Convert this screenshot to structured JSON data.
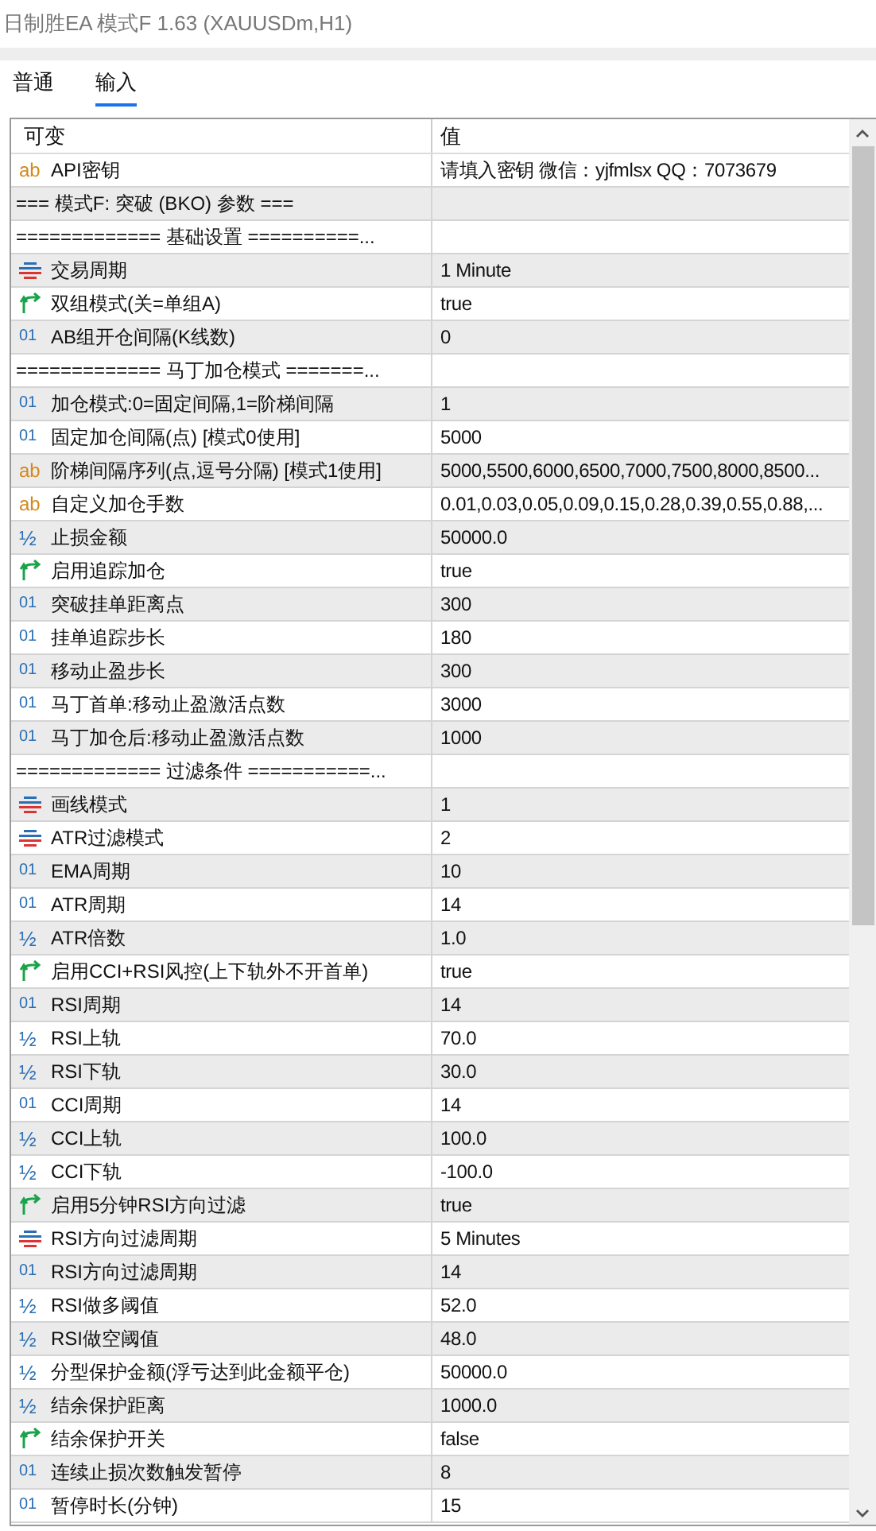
{
  "window": {
    "title": "日制胜EA 模式F 1.63 (XAUUSDm,H1)"
  },
  "tabs": [
    {
      "label": "普通",
      "selected": false
    },
    {
      "label": "输入",
      "selected": true
    }
  ],
  "table": {
    "columns": [
      "可变",
      "值"
    ],
    "rows": [
      {
        "kind": "string",
        "icon": "ab",
        "name": "API密钥",
        "value": "请填入密钥 微信：yjfmlsx QQ：7073679"
      },
      {
        "kind": "section",
        "name": "=== 模式F: 突破 (BKO) 参数 ==="
      },
      {
        "kind": "section",
        "name": "============= 基础设置 ==========..."
      },
      {
        "kind": "enum",
        "name": "交易周期",
        "value": "1 Minute"
      },
      {
        "kind": "bool",
        "name": "双组模式(关=单组A)",
        "value": "true"
      },
      {
        "kind": "int",
        "icon": "01",
        "name": "AB组开仓间隔(K线数)",
        "value": "0"
      },
      {
        "kind": "section",
        "name": "============= 马丁加仓模式 =======..."
      },
      {
        "kind": "int",
        "icon": "01",
        "name": "加仓模式:0=固定间隔,1=阶梯间隔",
        "value": "1"
      },
      {
        "kind": "int",
        "icon": "01",
        "name": "固定加仓间隔(点) [模式0使用]",
        "value": "5000"
      },
      {
        "kind": "string",
        "icon": "ab",
        "name": "阶梯间隔序列(点,逗号分隔) [模式1使用]",
        "value": "5000,5500,6000,6500,7000,7500,8000,8500..."
      },
      {
        "kind": "string",
        "icon": "ab",
        "name": "自定义加仓手数",
        "value": "0.01,0.03,0.05,0.09,0.15,0.28,0.39,0.55,0.88,..."
      },
      {
        "kind": "double",
        "icon": "½",
        "name": "止损金额",
        "value": "50000.0"
      },
      {
        "kind": "bool",
        "name": "启用追踪加仓",
        "value": "true"
      },
      {
        "kind": "int",
        "icon": "01",
        "name": "突破挂单距离点",
        "value": "300"
      },
      {
        "kind": "int",
        "icon": "01",
        "name": "挂单追踪步长",
        "value": "180"
      },
      {
        "kind": "int",
        "icon": "01",
        "name": "移动止盈步长",
        "value": "300"
      },
      {
        "kind": "int",
        "icon": "01",
        "name": "马丁首单:移动止盈激活点数",
        "value": "3000"
      },
      {
        "kind": "int",
        "icon": "01",
        "name": "马丁加仓后:移动止盈激活点数",
        "value": "1000"
      },
      {
        "kind": "section",
        "name": "============= 过滤条件 ===========..."
      },
      {
        "kind": "enum",
        "name": "画线模式",
        "value": "1"
      },
      {
        "kind": "enum",
        "name": "ATR过滤模式",
        "value": "2"
      },
      {
        "kind": "int",
        "icon": "01",
        "name": "EMA周期",
        "value": "10"
      },
      {
        "kind": "int",
        "icon": "01",
        "name": "ATR周期",
        "value": "14"
      },
      {
        "kind": "double",
        "icon": "½",
        "name": "ATR倍数",
        "value": "1.0"
      },
      {
        "kind": "bool",
        "name": "启用CCI+RSI风控(上下轨外不开首单)",
        "value": "true"
      },
      {
        "kind": "int",
        "icon": "01",
        "name": "RSI周期",
        "value": "14"
      },
      {
        "kind": "double",
        "icon": "½",
        "name": "RSI上轨",
        "value": "70.0"
      },
      {
        "kind": "double",
        "icon": "½",
        "name": "RSI下轨",
        "value": "30.0"
      },
      {
        "kind": "int",
        "icon": "01",
        "name": "CCI周期",
        "value": "14"
      },
      {
        "kind": "double",
        "icon": "½",
        "name": "CCI上轨",
        "value": "100.0"
      },
      {
        "kind": "double",
        "icon": "½",
        "name": "CCI下轨",
        "value": "-100.0"
      },
      {
        "kind": "bool",
        "name": "启用5分钟RSI方向过滤",
        "value": "true"
      },
      {
        "kind": "enum",
        "name": "RSI方向过滤周期",
        "value": "5 Minutes"
      },
      {
        "kind": "int",
        "icon": "01",
        "name": "RSI方向过滤周期",
        "value": "14"
      },
      {
        "kind": "double",
        "icon": "½",
        "name": "RSI做多阈值",
        "value": "52.0"
      },
      {
        "kind": "double",
        "icon": "½",
        "name": "RSI做空阈值",
        "value": "48.0"
      },
      {
        "kind": "double",
        "icon": "½",
        "name": "分型保护金额(浮亏达到此金额平仓)",
        "value": "50000.0"
      },
      {
        "kind": "double",
        "icon": "½",
        "name": "结余保护距离",
        "value": "1000.0"
      },
      {
        "kind": "bool",
        "name": "结余保护开关",
        "value": "false"
      },
      {
        "kind": "int",
        "icon": "01",
        "name": "连续止损次数触发暂停",
        "value": "8"
      },
      {
        "kind": "int",
        "icon": "01",
        "name": "暂停时长(分钟)",
        "value": "15"
      }
    ]
  }
}
